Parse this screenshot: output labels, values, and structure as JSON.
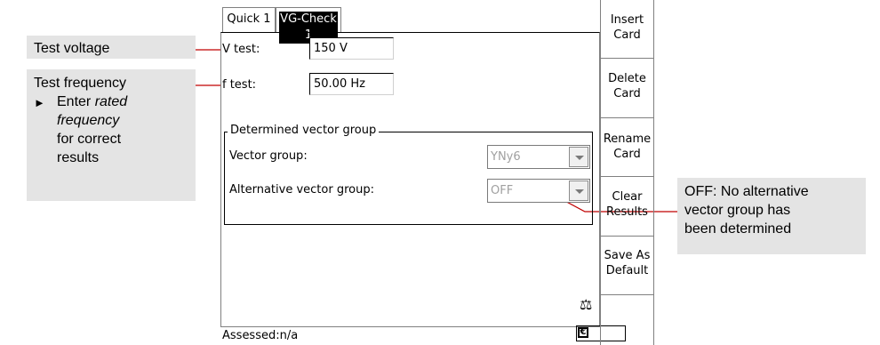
{
  "callouts": {
    "voltage": "Test voltage",
    "frequency_title": "Test frequency",
    "frequency_bullet_symbol": "►",
    "frequency_text_1": "Enter",
    "frequency_text_em1": "rated",
    "frequency_text_em2": "frequency",
    "frequency_text_2": "for correct",
    "frequency_text_3": "results",
    "off_line1": "OFF: No alternative",
    "off_line2": "vector group has",
    "off_line3": "been determined"
  },
  "tabs": [
    {
      "label": "Quick 1",
      "active": false
    },
    {
      "label": "VG-Check 1",
      "active": true
    }
  ],
  "fields": {
    "v_test_label": "V test:",
    "v_test_value": "150 V",
    "f_test_label": "f test:",
    "f_test_value": "50.00 Hz"
  },
  "group": {
    "title": "Determined vector group",
    "vector_group_label": "Vector group:",
    "vector_group_value": "YNy6",
    "alt_vector_group_label": "Alternative vector group:",
    "alt_vector_group_value": "OFF"
  },
  "status": {
    "assessed": "Assessed:n/a",
    "scale_icon": "scale-icon",
    "battery_icon": "battery-icon"
  },
  "sidebar": [
    {
      "line1": "Insert",
      "line2": "Card"
    },
    {
      "line1": "Delete",
      "line2": "Card"
    },
    {
      "line1": "Rename",
      "line2": "Card"
    },
    {
      "line1": "Clear",
      "line2": "Results"
    },
    {
      "line1": "Save As",
      "line2": "Default"
    }
  ],
  "colors": {
    "leader_line": "#c00000",
    "callout_bg": "#e4e4e4",
    "disabled_text": "#a0a0a0",
    "active_tab_bg": "#000000"
  }
}
